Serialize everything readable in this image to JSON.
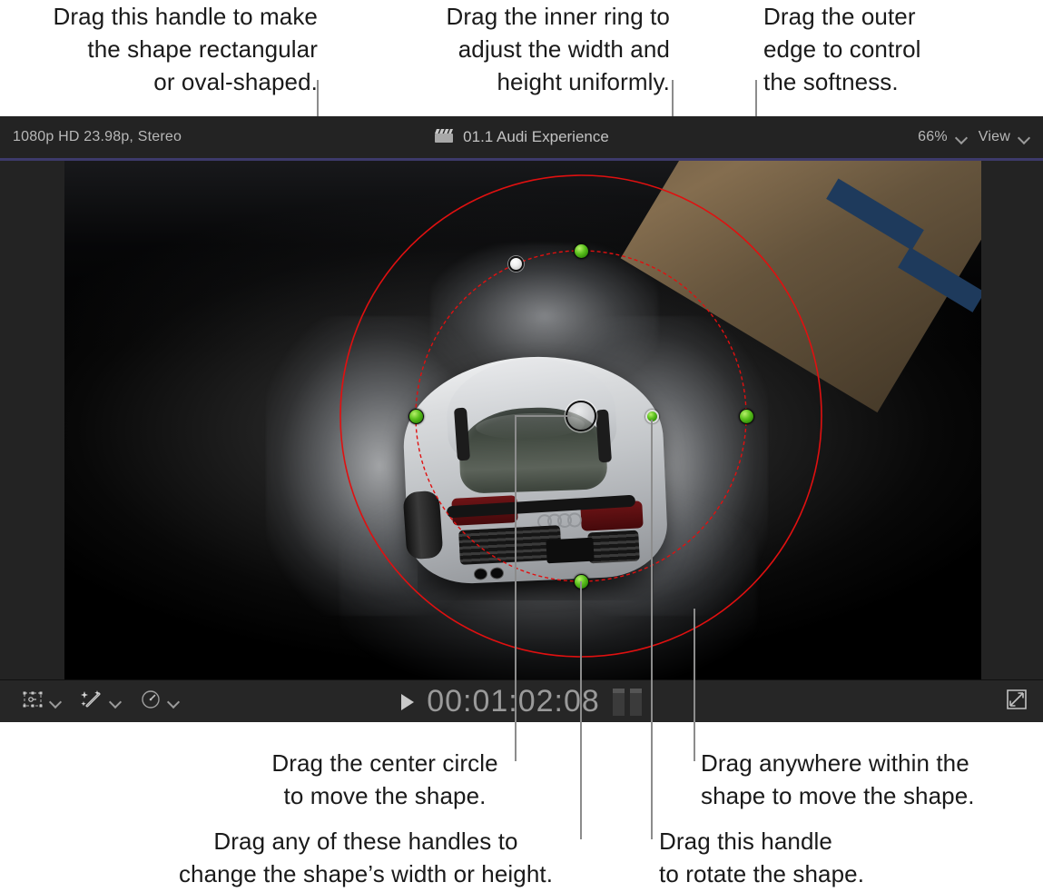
{
  "callouts": {
    "top_left": {
      "text": "Drag this handle to make\nthe shape rectangular\nor oval-shaped.",
      "align": "right"
    },
    "top_center": {
      "text": "Drag the inner ring to\nadjust the width and\nheight uniformly.",
      "align": "right"
    },
    "top_right": {
      "text": "Drag the outer\nedge to control\nthe softness.",
      "align": "left"
    },
    "bottom_left": {
      "text": "Drag the center circle\nto move the shape.",
      "align": "center"
    },
    "bottom_right": {
      "text": "Drag anywhere within the\nshape to move the shape.",
      "align": "left"
    },
    "bottom_low_left": {
      "text": "Drag any of these handles to\nchange the shape’s width or height.",
      "align": "center"
    },
    "bottom_low_right": {
      "text": "Drag this handle\nto rotate the shape.",
      "align": "left"
    }
  },
  "viewer": {
    "titlebar": {
      "format_label": "1080p HD 23.98p, Stereo",
      "project_icon": "clapperboard-icon",
      "project_title": "01.1 Audi Experience",
      "zoom_value": "66%",
      "zoom_chevron": "chevron-down-icon",
      "view_label": "View",
      "view_chevron": "chevron-down-icon"
    },
    "bottombar": {
      "transform_icon": "transform-handles-icon",
      "transform_chevron": "chevron-down-icon",
      "enhance_icon": "magic-wand-icon",
      "enhance_chevron": "chevron-down-icon",
      "retime_icon": "speedometer-icon",
      "retime_chevron": "chevron-down-icon",
      "play_icon": "play-triangle-icon",
      "timecode": "00:01:02:08",
      "audio_meter_icon": "audio-level-meters",
      "fullscreen_icon": "expand-arrows-icon"
    },
    "mask": {
      "outer_edge_color": "#e01010",
      "inner_ring_color": "#e01010",
      "handle_green_color": "#5cc11e",
      "handle_white_color": "#f0f0f0",
      "center_handle": "center-move-handle",
      "curvature_handle": "shape-curvature-handle",
      "rotate_handle": "rotate-handle",
      "size_handles": [
        "top-size-handle",
        "left-size-handle",
        "right-size-handle",
        "bottom-size-handle"
      ]
    }
  }
}
